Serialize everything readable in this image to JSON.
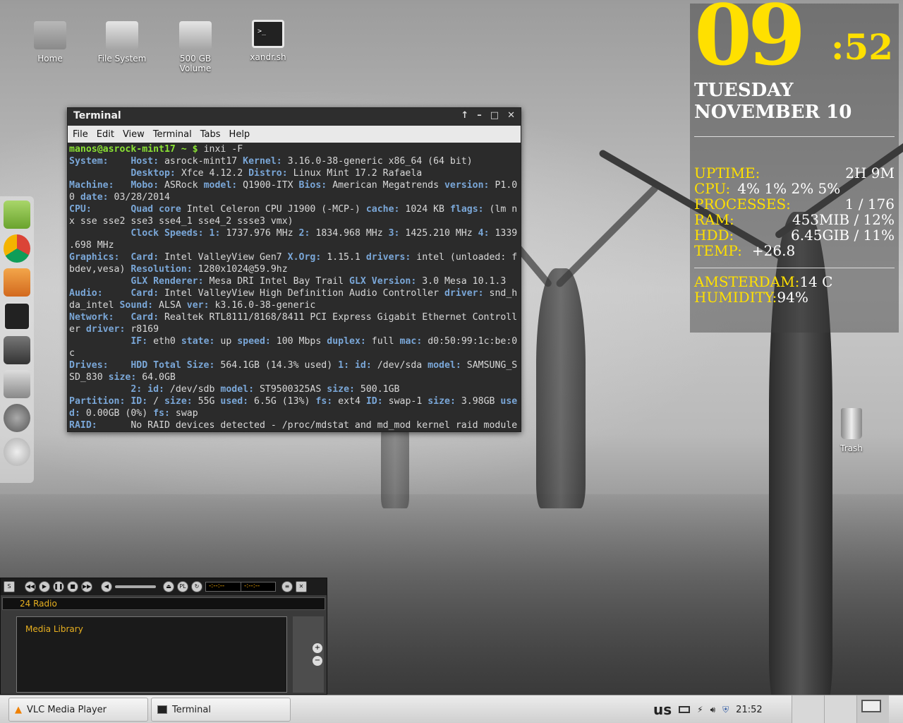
{
  "desktop": {
    "icons": [
      {
        "label": "Home"
      },
      {
        "label": "File System"
      },
      {
        "label": "500 GB Volume"
      },
      {
        "label": "xandr.sh"
      }
    ],
    "trash_label": "Trash"
  },
  "terminal": {
    "title": "Terminal",
    "controls": [
      "↑",
      "–",
      "□",
      "✕"
    ],
    "menu": [
      "File",
      "Edit",
      "View",
      "Terminal",
      "Tabs",
      "Help"
    ],
    "prompt": "manos@asrock-mint17 ~ $ ",
    "command": "inxi -F",
    "lines": [
      [
        [
          "k",
          "System:    "
        ],
        [
          "k",
          "Host: "
        ],
        [
          "t",
          "asrock-mint17 "
        ],
        [
          "k",
          "Kernel: "
        ],
        [
          "t",
          "3.16.0-38-generic x86_64 (64 bit)"
        ]
      ],
      [
        [
          "t",
          "           "
        ],
        [
          "k",
          "Desktop: "
        ],
        [
          "t",
          "Xfce 4.12.2 "
        ],
        [
          "k",
          "Distro: "
        ],
        [
          "t",
          "Linux Mint 17.2 Rafaela"
        ]
      ],
      [
        [
          "k",
          "Machine:   "
        ],
        [
          "k",
          "Mobo: "
        ],
        [
          "t",
          "ASRock "
        ],
        [
          "k",
          "model: "
        ],
        [
          "t",
          "Q1900-ITX "
        ],
        [
          "k",
          "Bios: "
        ],
        [
          "t",
          "American Megatrends "
        ],
        [
          "k",
          "version: "
        ],
        [
          "t",
          "P1.0"
        ]
      ],
      [
        [
          "t",
          "0 "
        ],
        [
          "k",
          "date: "
        ],
        [
          "t",
          "03/28/2014"
        ]
      ],
      [
        [
          "k",
          "CPU:       "
        ],
        [
          "k",
          "Quad core "
        ],
        [
          "t",
          "Intel Celeron CPU J1900 (-MCP-) "
        ],
        [
          "k",
          "cache: "
        ],
        [
          "t",
          "1024 KB "
        ],
        [
          "k",
          "flags: "
        ],
        [
          "t",
          "(lm n"
        ]
      ],
      [
        [
          "t",
          "x sse sse2 sse3 sse4_1 sse4_2 ssse3 vmx)"
        ]
      ],
      [
        [
          "t",
          "           "
        ],
        [
          "k",
          "Clock Speeds: "
        ],
        [
          "k",
          "1: "
        ],
        [
          "t",
          "1737.976 MHz "
        ],
        [
          "k",
          "2: "
        ],
        [
          "t",
          "1834.968 MHz "
        ],
        [
          "k",
          "3: "
        ],
        [
          "t",
          "1425.210 MHz "
        ],
        [
          "k",
          "4: "
        ],
        [
          "t",
          "1339"
        ]
      ],
      [
        [
          "t",
          ".698 MHz"
        ]
      ],
      [
        [
          "k",
          "Graphics:  "
        ],
        [
          "k",
          "Card: "
        ],
        [
          "t",
          "Intel ValleyView Gen7 "
        ],
        [
          "k",
          "X.Org: "
        ],
        [
          "t",
          "1.15.1 "
        ],
        [
          "k",
          "drivers: "
        ],
        [
          "t",
          "intel (unloaded: f"
        ]
      ],
      [
        [
          "t",
          "bdev,vesa) "
        ],
        [
          "k",
          "Resolution: "
        ],
        [
          "t",
          "1280x1024@59.9hz"
        ]
      ],
      [
        [
          "t",
          "           "
        ],
        [
          "k",
          "GLX Renderer: "
        ],
        [
          "t",
          "Mesa DRI Intel Bay Trail "
        ],
        [
          "k",
          "GLX Version: "
        ],
        [
          "t",
          "3.0 Mesa 10.1.3"
        ]
      ],
      [
        [
          "k",
          "Audio:     "
        ],
        [
          "k",
          "Card: "
        ],
        [
          "t",
          "Intel ValleyView High Definition Audio Controller "
        ],
        [
          "k",
          "driver: "
        ],
        [
          "t",
          "snd_h"
        ]
      ],
      [
        [
          "t",
          "da_intel "
        ],
        [
          "k",
          "Sound: "
        ],
        [
          "t",
          "ALSA "
        ],
        [
          "k",
          "ver: "
        ],
        [
          "t",
          "k3.16.0-38-generic"
        ]
      ],
      [
        [
          "k",
          "Network:   "
        ],
        [
          "k",
          "Card: "
        ],
        [
          "t",
          "Realtek RTL8111/8168/8411 PCI Express Gigabit Ethernet Controll"
        ]
      ],
      [
        [
          "t",
          "er "
        ],
        [
          "k",
          "driver: "
        ],
        [
          "t",
          "r8169"
        ]
      ],
      [
        [
          "t",
          "           "
        ],
        [
          "k",
          "IF: "
        ],
        [
          "t",
          "eth0 "
        ],
        [
          "k",
          "state: "
        ],
        [
          "t",
          "up "
        ],
        [
          "k",
          "speed: "
        ],
        [
          "t",
          "100 Mbps "
        ],
        [
          "k",
          "duplex: "
        ],
        [
          "t",
          "full "
        ],
        [
          "k",
          "mac: "
        ],
        [
          "t",
          "d0:50:99:1c:be:0"
        ]
      ],
      [
        [
          "t",
          "c"
        ]
      ],
      [
        [
          "k",
          "Drives:    "
        ],
        [
          "k",
          "HDD Total Size: "
        ],
        [
          "t",
          "564.1GB (14.3% used) "
        ],
        [
          "k",
          "1: id: "
        ],
        [
          "t",
          "/dev/sda "
        ],
        [
          "k",
          "model: "
        ],
        [
          "t",
          "SAMSUNG_S"
        ]
      ],
      [
        [
          "t",
          "SD_830 "
        ],
        [
          "k",
          "size: "
        ],
        [
          "t",
          "64.0GB"
        ]
      ],
      [
        [
          "t",
          "           "
        ],
        [
          "k",
          "2: id: "
        ],
        [
          "t",
          "/dev/sdb "
        ],
        [
          "k",
          "model: "
        ],
        [
          "t",
          "ST9500325AS "
        ],
        [
          "k",
          "size: "
        ],
        [
          "t",
          "500.1GB"
        ]
      ],
      [
        [
          "k",
          "Partition: "
        ],
        [
          "k",
          "ID: "
        ],
        [
          "t",
          "/ "
        ],
        [
          "k",
          "size: "
        ],
        [
          "t",
          "55G "
        ],
        [
          "k",
          "used: "
        ],
        [
          "t",
          "6.5G (13%) "
        ],
        [
          "k",
          "fs: "
        ],
        [
          "t",
          "ext4 "
        ],
        [
          "k",
          "ID: "
        ],
        [
          "t",
          "swap-1 "
        ],
        [
          "k",
          "size: "
        ],
        [
          "t",
          "3.98GB "
        ],
        [
          "k",
          "use"
        ]
      ],
      [
        [
          "k",
          "d: "
        ],
        [
          "t",
          "0.00GB (0%) "
        ],
        [
          "k",
          "fs: "
        ],
        [
          "t",
          "swap"
        ]
      ],
      [
        [
          "k",
          "RAID:      "
        ],
        [
          "t",
          "No RAID devices detected - /proc/mdstat and md_mod kernel raid module"
        ]
      ]
    ]
  },
  "conky": {
    "hour": "09",
    "minute": ":52",
    "day": "TUESDAY",
    "date": "NOVEMBER 10",
    "uptime_label": "UPTIME:",
    "uptime": "2H 9M",
    "cpu_label": "CPU:",
    "cpu": "4%  1%  2%  5%",
    "processes_label": "PROCESSES:",
    "processes": "1 / 176",
    "ram_label": "RAM:",
    "ram": "453MIB / 12%",
    "hdd_label": "HDD:",
    "hdd": "6.45GIB / 11%",
    "temp_label": "TEMP:",
    "temp": "+26.8",
    "city_label": "AMSTERDAM:",
    "city_temp": "14 C",
    "humidity_label": "HUMIDITY:",
    "humidity": "94%"
  },
  "media_player": {
    "time1": "-:--:--",
    "time2": "-:--:--",
    "station": "24 Radio",
    "library": "Media Library"
  },
  "taskbar": {
    "tasks": [
      "VLC Media Player",
      "Terminal"
    ],
    "keyboard": "us",
    "clock": "21:52"
  }
}
